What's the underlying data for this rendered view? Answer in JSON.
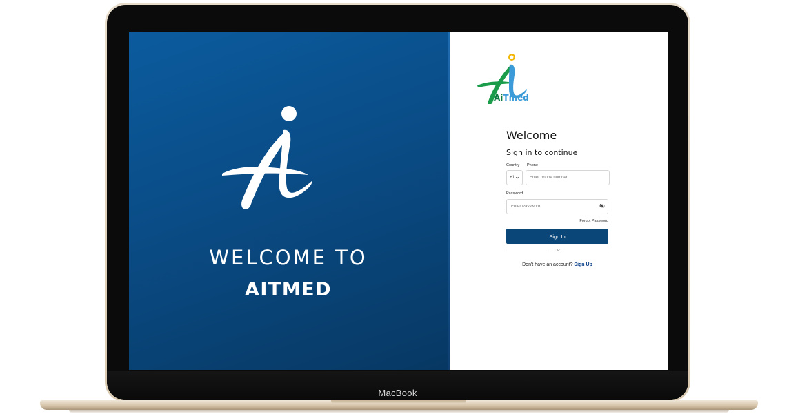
{
  "device": {
    "brand_label": "MacBook"
  },
  "hero": {
    "logo_name": "aitmed-mark-icon",
    "welcome_line1": "WELCOME TO",
    "welcome_line2": "AITMED"
  },
  "login": {
    "logo_text_main": "Ai",
    "logo_text_accent": "Tmed",
    "title": "Welcome",
    "subtitle": "Sign in to continue",
    "country_label": "Country",
    "phone_label": "Phone",
    "country_code": "+1",
    "phone_placeholder": "Enter phone number",
    "password_label": "Password",
    "password_placeholder": "Enter Password",
    "forgot_label": "Forgot Password",
    "signin_label": "Sign In",
    "or_label": "OR",
    "no_account_text": "Don't have an account? ",
    "signup_label": "Sign Up"
  },
  "colors": {
    "hero_blue": "#0a4c86",
    "button_navy": "#0a4678",
    "logo_green": "#0c7a3d",
    "logo_blue": "#3a9bd8",
    "logo_dot_yellow": "#f2b705"
  }
}
